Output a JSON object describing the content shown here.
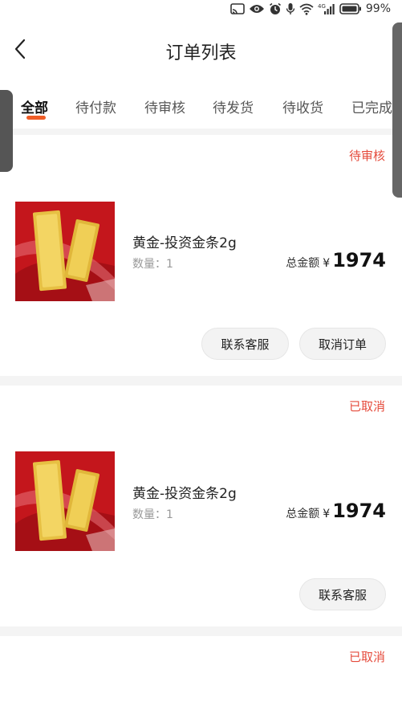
{
  "status_bar": {
    "battery_percent": "99%",
    "signal_label": "4G"
  },
  "nav": {
    "title": "订单列表"
  },
  "tabs": [
    {
      "label": "全部",
      "active": true
    },
    {
      "label": "待付款",
      "active": false
    },
    {
      "label": "待审核",
      "active": false
    },
    {
      "label": "待发货",
      "active": false
    },
    {
      "label": "待收货",
      "active": false
    },
    {
      "label": "已完成",
      "active": false
    }
  ],
  "orders": [
    {
      "status": "待审核",
      "product_name": "黄金-投资金条2g",
      "qty_label": "数量：",
      "qty": "1",
      "total_label": "总金额",
      "currency": "¥",
      "amount": "1974",
      "buttons": [
        "联系客服",
        "取消订单"
      ]
    },
    {
      "status": "已取消",
      "product_name": "黄金-投资金条2g",
      "qty_label": "数量：",
      "qty": "1",
      "total_label": "总金额",
      "currency": "¥",
      "amount": "1974",
      "buttons": [
        "联系客服"
      ]
    },
    {
      "status": "已取消"
    }
  ],
  "colors": {
    "accent": "#ef5d27",
    "status_red": "#e54b3c"
  }
}
